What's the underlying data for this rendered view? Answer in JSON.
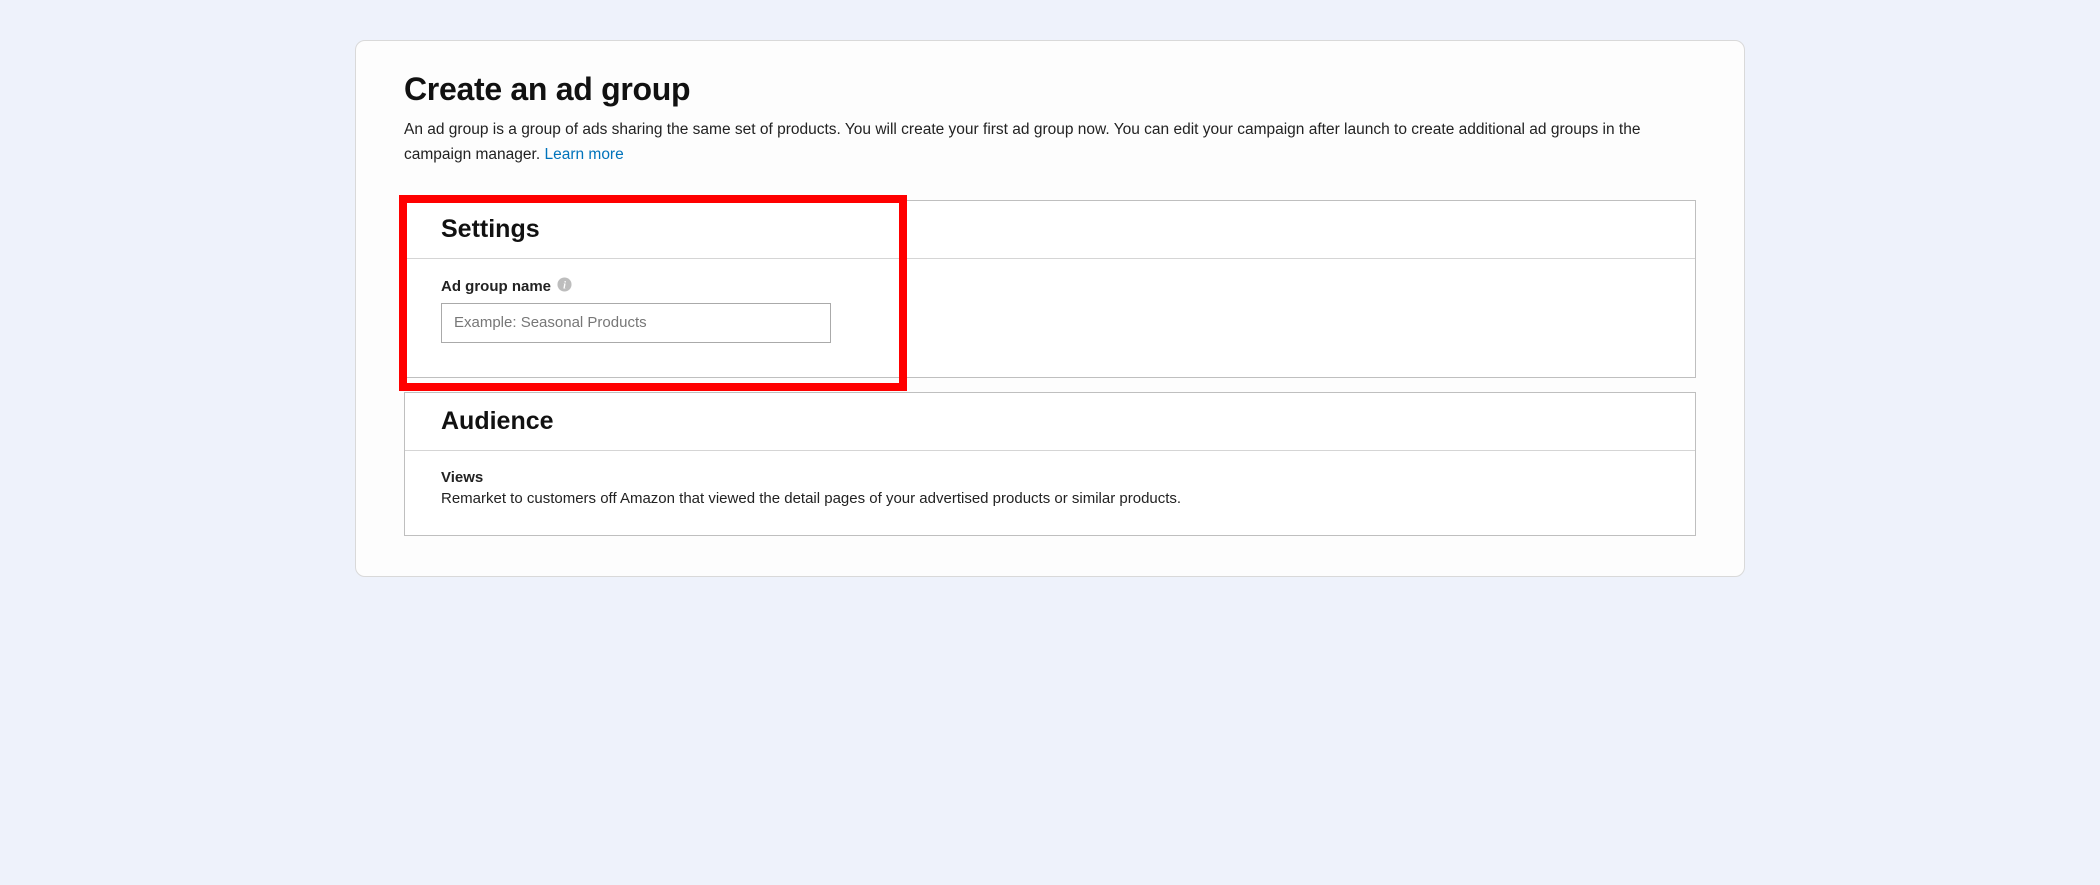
{
  "header": {
    "title": "Create an ad group",
    "description": "An ad group is a group of ads sharing the same set of products. You will create your first ad group now. You can edit your campaign after launch to create additional ad groups in the campaign manager. ",
    "learn_more": "Learn more"
  },
  "settings_panel": {
    "title": "Settings",
    "field": {
      "label": "Ad group name",
      "placeholder": "Example: Seasonal Products",
      "value": ""
    }
  },
  "audience_panel": {
    "title": "Audience",
    "views_label": "Views",
    "views_desc": "Remarket to customers off Amazon that viewed the detail pages of your advertised products or similar products."
  }
}
